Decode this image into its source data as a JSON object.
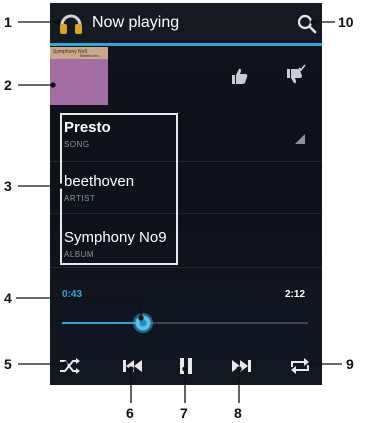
{
  "header": {
    "title": "Now playing",
    "app_icon": "headphones-icon",
    "search_icon": "search-icon",
    "accent_color": "#2ea6d8"
  },
  "album_art": {
    "caption": "Symphony No9",
    "sub_caption": "Beethoven"
  },
  "rating": {
    "like_icon": "thumbs-up-icon",
    "dislike_icon": "thumbs-down-icon"
  },
  "track_info": {
    "song": "Presto",
    "song_label": "SONG",
    "artist": "beethoven",
    "artist_label": "ARTIST",
    "album": "Symphony No9",
    "album_label": "ALBUM"
  },
  "progress": {
    "elapsed": "0:43",
    "total": "2:12",
    "fraction": 0.33
  },
  "controls": {
    "shuffle_icon": "shuffle-icon",
    "previous_icon": "previous-icon",
    "pause_icon": "pause-icon",
    "next_icon": "next-icon",
    "repeat_icon": "repeat-icon"
  },
  "callouts": [
    "1",
    "2",
    "3",
    "4",
    "5",
    "6",
    "7",
    "8",
    "9",
    "10"
  ]
}
